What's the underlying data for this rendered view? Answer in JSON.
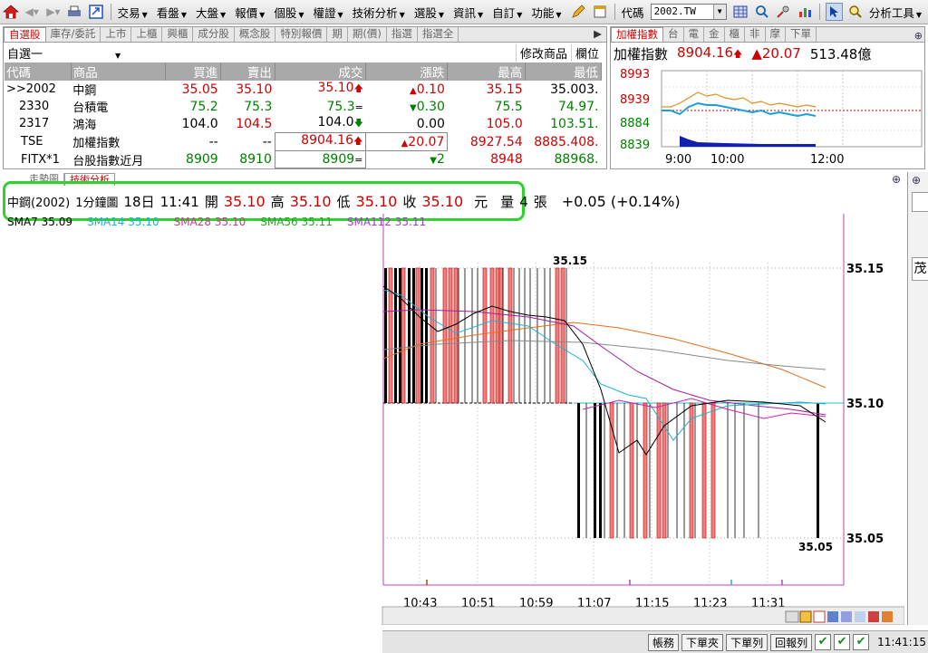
{
  "toolbar": {
    "menus": [
      "交易",
      "看盤",
      "大盤",
      "報價",
      "個股",
      "權證",
      "技術分析",
      "選股",
      "資訊",
      "自訂",
      "功能"
    ],
    "code_label": "代碼",
    "code_value": "2002.TW",
    "analysis_tools": "分析工具"
  },
  "quote_panel": {
    "tabs": [
      "自選股",
      "庫存/委託",
      "上市",
      "上櫃",
      "興櫃",
      "成分股",
      "概念股",
      "特別報價",
      "期",
      "期(價)",
      "指選",
      "指選全"
    ],
    "list_name": "自選一",
    "edit_label": "修改商品",
    "col_label": "欄位",
    "columns": [
      "代碼",
      "商品",
      "買進",
      "賣出",
      "成交",
      "漲跌",
      "最高",
      "最低"
    ],
    "rows": [
      {
        "code": ">>2002",
        "name": "中鋼",
        "bid": "35.05",
        "ask": "35.10",
        "last": "35.10",
        "chg": "0.10",
        "high": "35.15",
        "low": "35.003."
      },
      {
        "code": "2330",
        "name": "台積電",
        "bid": "75.2",
        "ask": "75.3",
        "last": "75.3",
        "chg": "0.30",
        "high": "75.5",
        "low": "74.97."
      },
      {
        "code": "2317",
        "name": "鴻海",
        "bid": "104.0",
        "ask": "104.5",
        "last": "104.0",
        "chg": "0.00",
        "high": "105.0",
        "low": "103.51."
      },
      {
        "code": "TSE",
        "name": "加權指數",
        "bid": "--",
        "ask": "--",
        "last": "8904.16",
        "chg": "20.07",
        "high": "8927.54",
        "low": "8885.408."
      },
      {
        "code": "FITX*1",
        "name": "台股指數近月",
        "bid": "8909",
        "ask": "8910",
        "last": "8909",
        "chg": "2",
        "high": "8948",
        "low": "88968."
      }
    ]
  },
  "index_panel": {
    "tabs": [
      "加權指數",
      "台",
      "電",
      "金",
      "櫃",
      "非",
      "摩",
      "下單"
    ],
    "title": "加權指數",
    "value": "8904.16",
    "change": "20.07",
    "volume": "513.48億",
    "y_ticks": [
      "8993",
      "8939",
      "8884",
      "8839"
    ],
    "x_ticks": [
      "9:00",
      "10:00",
      "12:00"
    ],
    "colors": {
      "accent": "#cc0000",
      "line1": "#e09020",
      "line2": "#1aa0d8",
      "vol": "#1020b0"
    }
  },
  "chart_panel": {
    "tabs": [
      "走勢圖",
      "技術分析"
    ],
    "info": {
      "name": "中鋼(2002)",
      "period": "1分鐘圖",
      "date": "18日",
      "time": "11:41",
      "open_label": "開",
      "open": "35.10",
      "high_label": "高",
      "high": "35.10",
      "low_label": "低",
      "low": "35.10",
      "close_label": "收",
      "close": "35.10",
      "unit": "元",
      "vol_label": "量",
      "vol": "4",
      "vol_unit": "張",
      "change": "+0.05 (+0.14%)"
    },
    "sma": [
      "SMA7 35.09",
      "SMA14 35.10",
      "SMA28 35.10",
      "SMA56 35.11",
      "SMA112 35.11"
    ]
  },
  "chart_data": {
    "type": "bar",
    "title": "",
    "y_ticks": [
      "35.15",
      "35.10",
      "35.05"
    ],
    "x_ticks": [
      "10:43",
      "10:51",
      "10:59",
      "11:07",
      "11:15",
      "11:23",
      "11:31"
    ],
    "ylim": [
      35.05,
      35.15
    ],
    "max_label": "35.15",
    "min_label": "35.05"
  },
  "statusbar": {
    "buttons": [
      "帳務",
      "下單夾",
      "下單列",
      "回報列"
    ],
    "clock": "11:41:15"
  }
}
